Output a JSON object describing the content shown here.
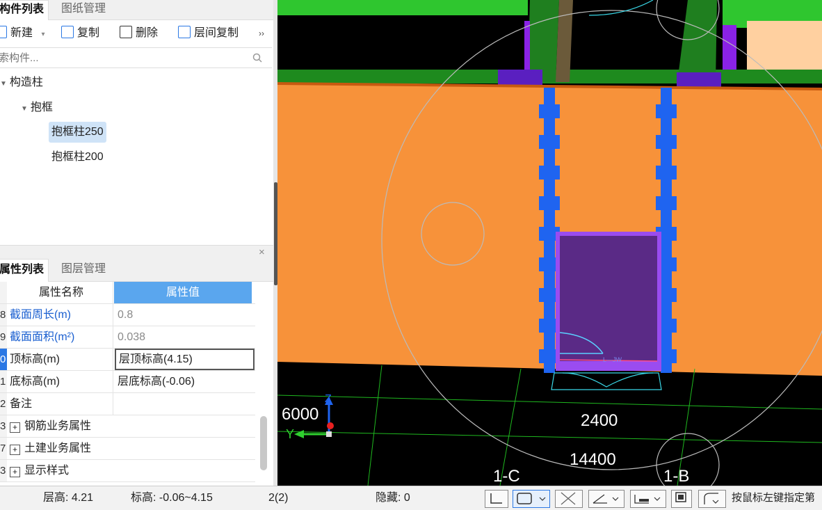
{
  "top_tabs": [
    "构件列表",
    "图纸管理"
  ],
  "toolbar": {
    "new": "新建",
    "copy": "复制",
    "delete": "删除",
    "floor_copy": "层间复制",
    "more": "››"
  },
  "search": {
    "placeholder": "索构件..."
  },
  "tree": {
    "root": "构造柱",
    "group": "抱框",
    "items": [
      "抱框柱250",
      "抱框柱200"
    ]
  },
  "prop_tabs": [
    "属性列表",
    "图层管理"
  ],
  "prop_headers": {
    "name": "属性名称",
    "value": "属性值"
  },
  "props": [
    {
      "idx": "8",
      "name": "截面周长(m)",
      "value": "0.8"
    },
    {
      "idx": "9",
      "name": "截面面积(m²)",
      "value": "0.038"
    },
    {
      "idx": "0",
      "name": "顶标高(m)",
      "value": "层顶标高(4.15)"
    },
    {
      "idx": "1",
      "name": "底标高(m)",
      "value": "层底标高(-0.06)"
    },
    {
      "idx": "2",
      "name": "备注",
      "value": ""
    },
    {
      "idx": "3",
      "name": "钢筋业务属性",
      "value": ""
    },
    {
      "idx": "7",
      "name": "土建业务属性",
      "value": ""
    },
    {
      "idx": "3",
      "name": "显示样式",
      "value": ""
    }
  ],
  "viewport": {
    "dim_6000": "6000",
    "dim_2400": "2400",
    "dim_14400": "14400",
    "axis_1c": "1-C",
    "axis_1b": "1-B",
    "axis_z": "Z",
    "axis_y": "Y",
    "door_text": "L—JW"
  },
  "status": {
    "floor_height": "层高: 4.21",
    "elevation": "标高: -0.06~4.15",
    "count": "2(2)",
    "hidden": "隐藏: 0",
    "hint": "按鼠标左键指定第"
  },
  "colors": {
    "wall_orange": "#f7923a",
    "column_blue": "#1f64f0",
    "door_purple": "#5a2a86",
    "slab_green": "#2fc62f"
  }
}
